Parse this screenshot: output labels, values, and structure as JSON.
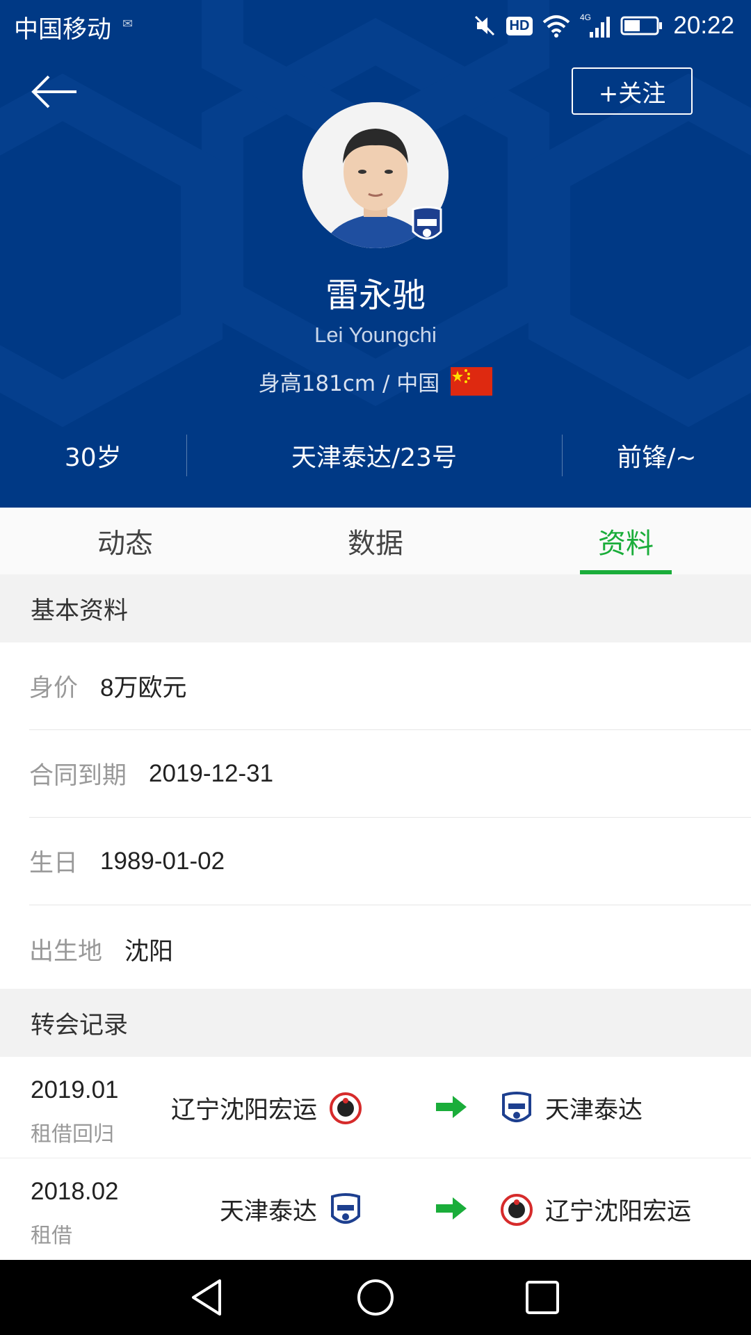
{
  "status_bar": {
    "carrier": "中国移动",
    "hd_label": "HD",
    "network_label": "4G",
    "time": "20:22"
  },
  "header": {
    "follow_label": "+关注",
    "player_name": "雷永驰",
    "player_name_en": "Lei Youngchi",
    "meta": "身高181cm / 中国",
    "stats": {
      "age": "30岁",
      "team_number": "天津泰达/23号",
      "position": "前锋/~"
    }
  },
  "tabs": [
    {
      "label": "动态",
      "active": false
    },
    {
      "label": "数据",
      "active": false
    },
    {
      "label": "资料",
      "active": true
    }
  ],
  "basic_info": {
    "title": "基本资料",
    "rows": [
      {
        "label": "身价",
        "value": "8万欧元"
      },
      {
        "label": "合同到期",
        "value": "2019-12-31"
      },
      {
        "label": "生日",
        "value": "1989-01-02"
      },
      {
        "label": "出生地",
        "value": "沈阳"
      }
    ]
  },
  "transfers": {
    "title": "转会记录",
    "rows": [
      {
        "date": "2019.01",
        "type": "租借回归",
        "from": "辽宁沈阳宏运",
        "to": "天津泰达"
      },
      {
        "date": "2018.02",
        "type": "租借",
        "from": "天津泰达",
        "to": "辽宁沈阳宏运"
      }
    ]
  },
  "colors": {
    "header_bg": "#003985",
    "accent_green": "#1aad3a"
  },
  "icons": {
    "back": "arrow-left-icon",
    "transfer": "arrow-right-icon",
    "nav_back": "triangle-back-icon",
    "nav_home": "circle-home-icon",
    "nav_recent": "square-recent-icon"
  }
}
